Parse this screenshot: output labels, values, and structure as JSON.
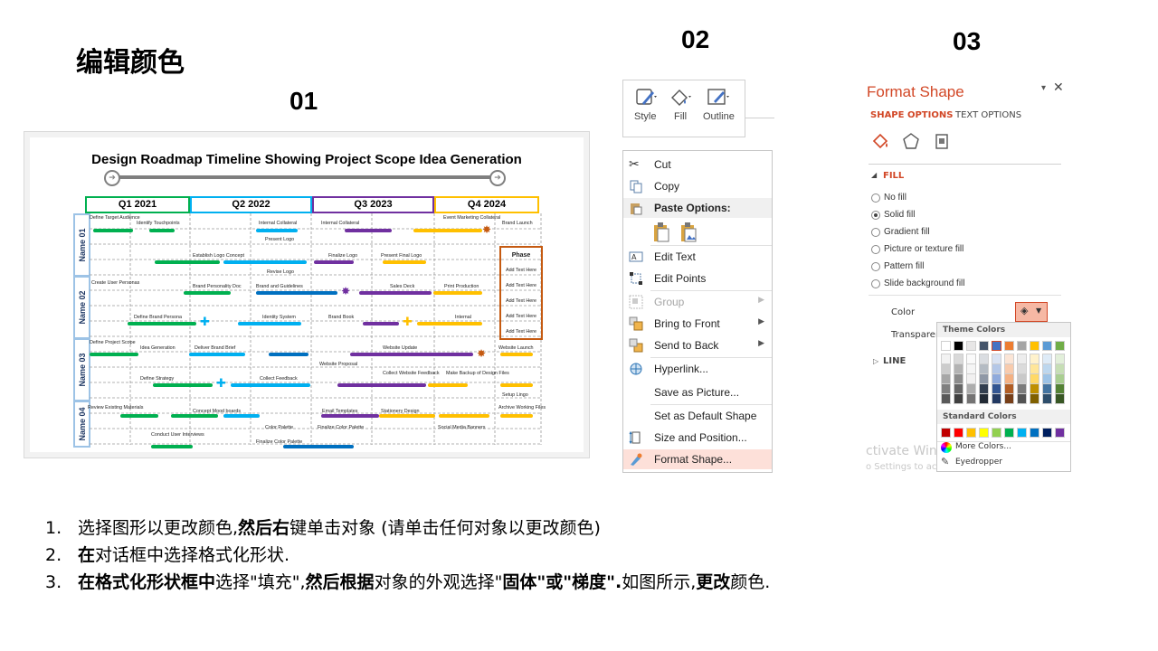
{
  "heading": "编辑颜色",
  "labels": {
    "n01": "01",
    "n02": "02",
    "n03": "03"
  },
  "roadmap": {
    "title": "Design Roadmap Timeline Showing Project Scope Idea Generation",
    "quarters": [
      "Q1 2021",
      "Q2 2022",
      "Q3 2023",
      "Q4 2024"
    ],
    "rows": [
      "Name 01",
      "Name 02",
      "Name 03",
      "Name 04"
    ],
    "phase": "Phase",
    "add_text": "Add Text Here",
    "tasks": [
      "Define Target Audience",
      "Identify Touchpoints",
      "Internal Collateral",
      "Internal Collateral",
      "Event Marketing Collateral",
      "Brand Launch",
      "Present Logo",
      "Establish Logo Concept",
      "Finalize Logo",
      "Present Final Logo",
      "Revise Logo",
      "Create User Personas",
      "Brand Personality Doc",
      "Brand and Guidelines",
      "Sales Deck",
      "Print Production",
      "Define Brand Persona",
      "Identity System",
      "Brand Book",
      "Internal",
      "Define Project Scope",
      "Idea Generation",
      "Deliver Brand Brief",
      "Website Update",
      "Website Launch",
      "Website Proposal",
      "Define Strategy",
      "Collect Feedback",
      "Collect Website Feedback",
      "Make Backup of Design Files",
      "Setup Lingo",
      "Review Existing Materials",
      "Concept Mood boards",
      "Email Templates",
      "Stationery Design",
      "Archive Working Files",
      "Color Palette",
      "Finalize Color Palette",
      "Social Media Banners",
      "Conduct User Interviews",
      "Finalize Color Palette"
    ],
    "colors": {
      "q1": "#00b050",
      "q2": "#00b0f0",
      "q3": "#7030a0",
      "q4": "#ffc000",
      "dark": "#0070c0",
      "orange": "#c55a11"
    }
  },
  "ribbon": {
    "style": "Style",
    "fill": "Fill",
    "outline": "Outline"
  },
  "context_menu": {
    "cut": "Cut",
    "copy": "Copy",
    "paste_options": "Paste Options:",
    "edit_text": "Edit Text",
    "edit_points": "Edit Points",
    "group": "Group",
    "bring_to_front": "Bring to Front",
    "send_to_back": "Send to Back",
    "hyperlink": "Hyperlink...",
    "save_as_picture": "Save as Picture...",
    "set_default": "Set as Default Shape",
    "size_position": "Size and Position...",
    "format_shape": "Format Shape..."
  },
  "format_shape": {
    "title": "Format Shape",
    "tab_shape": "SHAPE OPTIONS",
    "tab_text": "TEXT OPTIONS",
    "fill_section": "FILL",
    "options": [
      "No fill",
      "Solid fill",
      "Gradient fill",
      "Picture or texture fill",
      "Pattern fill",
      "Slide background fill"
    ],
    "selected_option": "Solid fill",
    "color_label": "Color",
    "transparency_label": "Transparen",
    "line_section": "LINE",
    "theme_colors": "Theme Colors",
    "standard_colors": "Standard Colors",
    "more_colors": "More Colors...",
    "eyedropper": "Eyedropper",
    "watermark1": "ctivate Windows",
    "watermark2": "o Settings to activate Windows.",
    "theme_top": [
      "#ffffff",
      "#000000",
      "#e7e6e6",
      "#44546a",
      "#4472c4",
      "#ed7d31",
      "#a5a5a5",
      "#ffc000",
      "#5b9bd5",
      "#70ad47"
    ],
    "standard": [
      "#c00000",
      "#ff0000",
      "#ffc000",
      "#ffff00",
      "#92d050",
      "#00b050",
      "#00b0f0",
      "#0070c0",
      "#002060",
      "#7030a0"
    ]
  },
  "steps": [
    {
      "num": "1.",
      "parts": [
        {
          "t": "选择图形以更改颜色,",
          "b": false
        },
        {
          "t": "然后右",
          "b": true
        },
        {
          "t": "键单击对象 (请单击任何对象以更改颜色)",
          "b": false
        }
      ]
    },
    {
      "num": "2.",
      "parts": [
        {
          "t": "在",
          "b": true
        },
        {
          "t": "对话框中选择格式化形状.",
          "b": false
        }
      ]
    },
    {
      "num": "3.",
      "parts": [
        {
          "t": "在格式化形状框中",
          "b": true
        },
        {
          "t": "选择\"填充\",",
          "b": false
        },
        {
          "t": "然后根据",
          "b": true
        },
        {
          "t": "对象的外观选择\"",
          "b": false
        },
        {
          "t": "固体\"或\"梯度\".",
          "b": true
        },
        {
          "t": "如图所示,",
          "b": false
        },
        {
          "t": "更改",
          "b": true
        },
        {
          "t": "颜色.",
          "b": false
        }
      ]
    }
  ]
}
